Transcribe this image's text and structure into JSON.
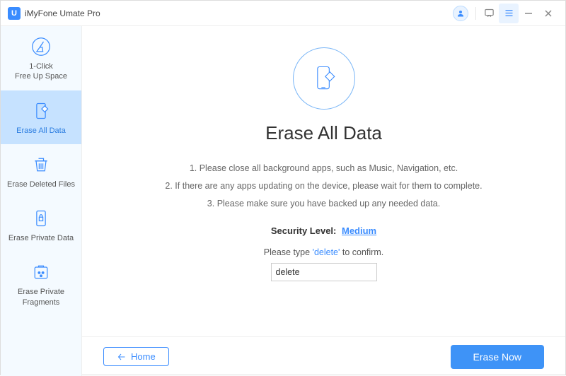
{
  "app": {
    "name": "iMyFone Umate Pro",
    "logo_letter": "U"
  },
  "sidebar": {
    "items": [
      {
        "label": "1-Click\nFree Up Space"
      },
      {
        "label": "Erase All Data"
      },
      {
        "label": "Erase Deleted Files"
      },
      {
        "label": "Erase Private Data"
      },
      {
        "label": "Erase Private\nFragments"
      }
    ],
    "active_index": 1
  },
  "main": {
    "title": "Erase All Data",
    "steps": [
      "1. Please close all background apps, such as Music, Navigation, etc.",
      "2. If there are any apps updating on the device, please wait for them to complete.",
      "3. Please make sure you have backed up any needed data."
    ],
    "security_label": "Security Level:",
    "security_value": "Medium",
    "confirm_prefix": "Please type ",
    "confirm_keyword": "'delete'",
    "confirm_suffix": " to confirm.",
    "confirm_value": "delete"
  },
  "footer": {
    "home_label": "Home",
    "erase_label": "Erase Now"
  }
}
